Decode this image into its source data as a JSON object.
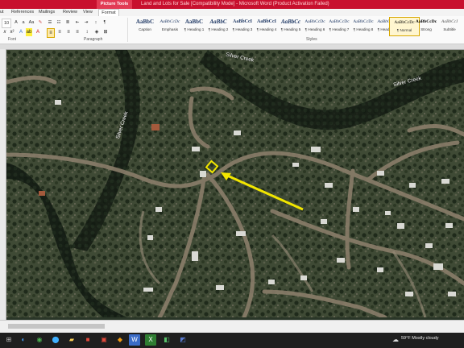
{
  "window": {
    "context_tab": "Picture Tools",
    "title": "Land and Lots for Sale [Compatibility Mode] - Microsoft Word (Product Activation Failed)"
  },
  "tabs": [
    {
      "label": "ut"
    },
    {
      "label": "References"
    },
    {
      "label": "Mailings"
    },
    {
      "label": "Review"
    },
    {
      "label": "View"
    },
    {
      "label": "Format"
    }
  ],
  "font": {
    "size": "10",
    "group_label": "Font",
    "paragraph_label": "Paragraph",
    "styles_label": "Styles"
  },
  "styles": [
    {
      "preview": "AaBbC",
      "name": "Caption"
    },
    {
      "preview": "AaBbCcDc",
      "name": "Emphasis"
    },
    {
      "preview": "AaBbC",
      "name": "¶ Heading 1"
    },
    {
      "preview": "AaBbC",
      "name": "¶ Heading 2"
    },
    {
      "preview": "AaBbCcI",
      "name": "¶ Heading 3"
    },
    {
      "preview": "AaBbCcI",
      "name": "¶ Heading 4"
    },
    {
      "preview": "AaBbCc",
      "name": "¶ Heading 5"
    },
    {
      "preview": "AaBbCcDc",
      "name": "¶ Heading 6"
    },
    {
      "preview": "AaBbCcDc",
      "name": "¶ Heading 7"
    },
    {
      "preview": "AaBbCcDc",
      "name": "¶ Heading 8"
    },
    {
      "preview": "AaBbCcDc",
      "name": "¶ Heading 9"
    },
    {
      "preview": "AaBbCcDc",
      "name": "¶ Normal"
    },
    {
      "preview": "AaBbCcDc",
      "name": "Strong"
    },
    {
      "preview": "AaBbCcI",
      "name": "Subtitle"
    }
  ],
  "map": {
    "labels": [
      "Silver Creek",
      "Silver Creek",
      "Silver Creek"
    ],
    "marker_color": "#f2e600"
  },
  "taskbar": {
    "weather_temp": "59°F",
    "weather_text": "Mostly cloudy"
  }
}
